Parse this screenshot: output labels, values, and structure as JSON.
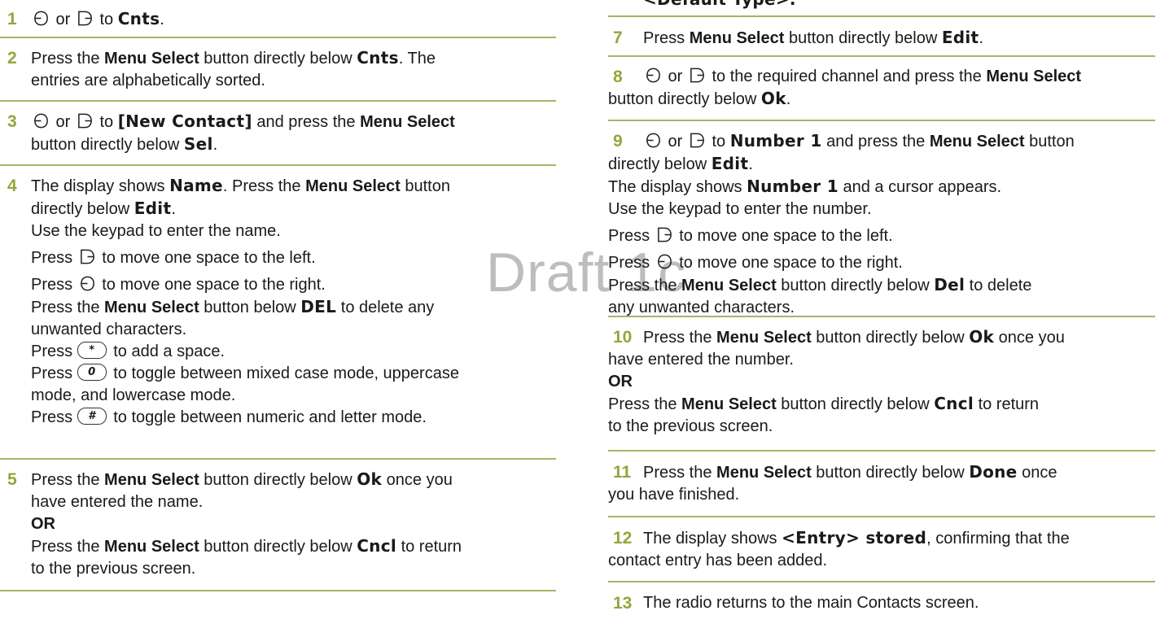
{
  "watermark": "Draft 1c",
  "icons": {
    "left": "nav-left-icon",
    "right": "nav-right-icon"
  },
  "accent_color": "#8fa83c",
  "rule_color": "#a8b464",
  "left": {
    "s1": {
      "n": "1",
      "or": " or ",
      "to": " to ",
      "target": "Cnts",
      "end": "."
    },
    "s2": {
      "n": "2",
      "a": "Press the ",
      "ms": "Menu Select",
      "b": " button directly below ",
      "t": "Cnts",
      "c": ". The",
      "d": "entries are alphabetically sorted."
    },
    "s3": {
      "n": "3",
      "or": " or ",
      "to": " to ",
      "t": "[New Contact]",
      "a": " and press the ",
      "ms": "Menu Select",
      "b": "button directly below ",
      "t2": "Sel",
      "end": "."
    },
    "s4": {
      "n": "4",
      "l1a": "The display shows ",
      "l1t": "Name",
      "l1b": ". Press the ",
      "l1ms": "Menu Select",
      "l1c": " button",
      "l2a": "directly below ",
      "l2t": "Edit",
      "l2b": ".",
      "l3": "Use the keypad to enter the name.",
      "l4a": "Press ",
      "l4b": " to move one space to the left.",
      "l5a": "Press ",
      "l5b": " to move one space to the right.",
      "l6a": "Press the ",
      "l6ms": "Menu Select",
      "l6b": " button below ",
      "l6t": "DEL",
      "l6c": " to delete any",
      "l7": "unwanted characters.",
      "l8a": "Press ",
      "l8k": "*",
      "l8b": " to add a space.",
      "l9a": "Press ",
      "l9k": "0",
      "l9b": " to toggle between mixed case mode, uppercase",
      "l10": "mode, and lowercase mode.",
      "l11a": "Press ",
      "l11k": "#",
      "l11b": " to toggle between numeric and letter mode."
    },
    "s5": {
      "n": "5",
      "l1a": "Press the ",
      "l1ms": "Menu Select",
      "l1b": " button directly below ",
      "l1t": "Ok",
      "l1c": " once you",
      "l2": "have entered the name.",
      "l3": "OR",
      "l4a": "Press the ",
      "l4ms": "Menu Select",
      "l4b": " button directly below ",
      "l4t": "Cncl",
      "l4c": " to return",
      "l5": "to the previous screen."
    }
  },
  "right": {
    "top": "<Default Type>.",
    "s7": {
      "n": "7",
      "a": "Press ",
      "ms": "Menu Select",
      "b": " button directly below ",
      "t": "Edit",
      "c": "."
    },
    "s8": {
      "n": "8",
      "or": " or ",
      "a": " to the required channel and press the ",
      "ms": "Menu Select",
      "b": "button directly below ",
      "t": "Ok",
      "c": "."
    },
    "s9": {
      "n": "9",
      "or": " or ",
      "to": " to ",
      "t1": "Number 1",
      "a": " and press the ",
      "ms": "Menu Select",
      "b": " button",
      "l2a": "directly below ",
      "l2t": "Edit",
      "l2b": ".",
      "l3a": "The display shows ",
      "l3t": "Number 1",
      "l3b": " and a cursor appears.",
      "l4": "Use the keypad to enter the number.",
      "l5a": "Press ",
      "l5b": " to move one space to the left.",
      "l6a": "Press ",
      "l6b": " to move one space to the right.",
      "l7a": "Press the ",
      "l7ms": "Menu Select",
      "l7b": " button directly below ",
      "l7t": "Del",
      "l7c": " to delete",
      "l8": "any unwanted characters."
    },
    "s10": {
      "n": "10",
      "l1a": "Press the ",
      "l1ms": "Menu Select",
      "l1b": " button directly below ",
      "l1t": "Ok",
      "l1c": " once you",
      "l2": "have entered the number.",
      "l3": "OR",
      "l4a": "Press the ",
      "l4ms": "Menu Select",
      "l4b": " button directly below ",
      "l4t": "Cncl",
      "l4c": " to return",
      "l5": "to the previous screen."
    },
    "s11": {
      "n": "11",
      "a": "Press the ",
      "ms": "Menu Select",
      "b": " button directly below ",
      "t": "Done",
      "c": " once",
      "d": "you have finished."
    },
    "s12": {
      "n": "12",
      "a": "The display shows ",
      "t": "<Entry> stored",
      "b": ", confirming that the",
      "c": "contact entry has been added."
    },
    "s13": {
      "n": "13",
      "a": "The radio returns to the main Contacts screen."
    }
  }
}
